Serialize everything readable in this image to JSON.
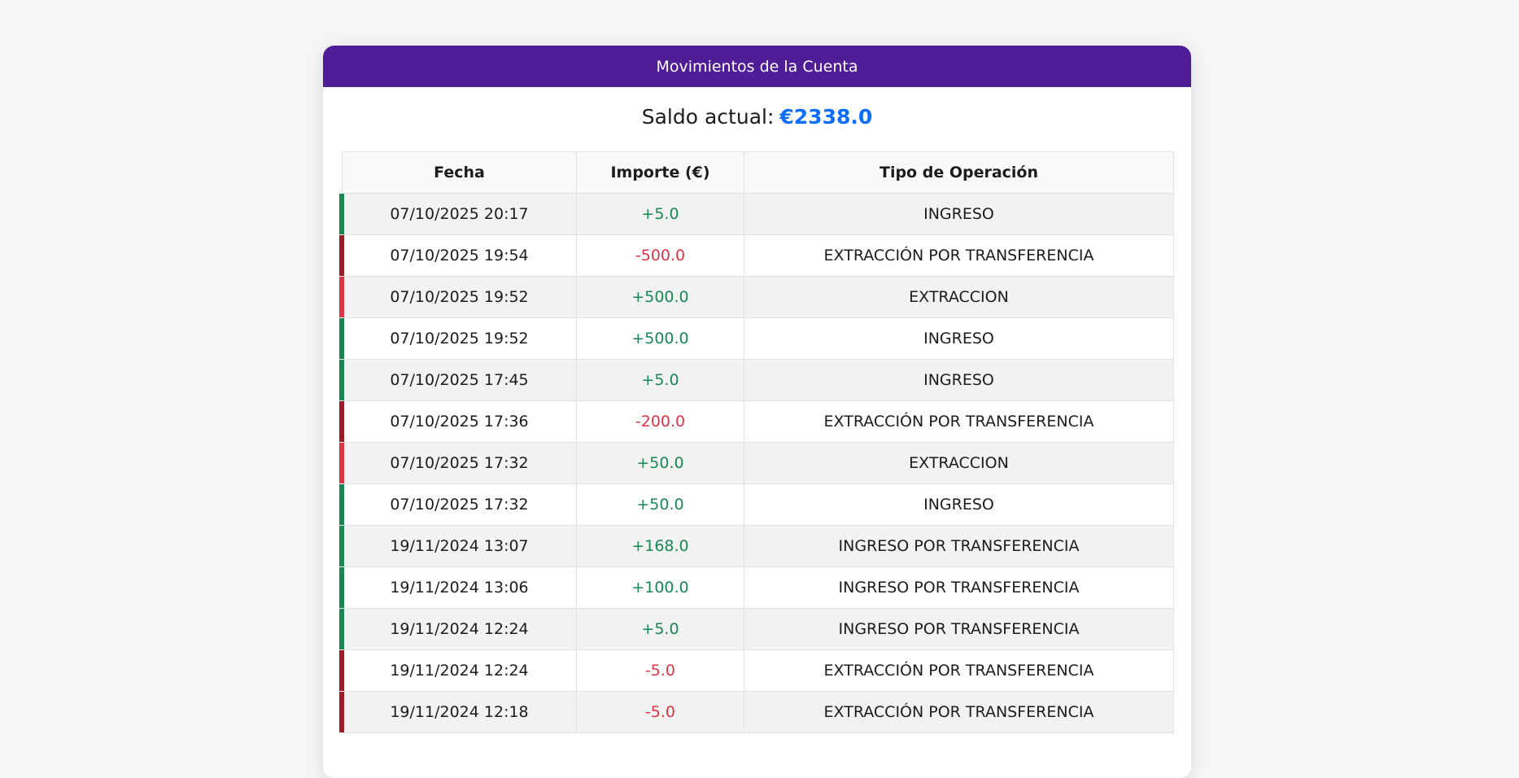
{
  "header": {
    "title": "Movimientos de la Cuenta"
  },
  "balance": {
    "label": "Saldo actual:",
    "value": "€2338.0"
  },
  "table": {
    "columns": [
      "Fecha",
      "Importe (€)",
      "Tipo de Operación"
    ],
    "rows": [
      {
        "date": "07/10/2025 20:17",
        "amount": "+5.0",
        "type": "INGRESO"
      },
      {
        "date": "07/10/2025 19:54",
        "amount": "-500.0",
        "type": "EXTRACCIÓN POR TRANSFERENCIA"
      },
      {
        "date": "07/10/2025 19:52",
        "amount": "+500.0",
        "type": "EXTRACCION"
      },
      {
        "date": "07/10/2025 19:52",
        "amount": "+500.0",
        "type": "INGRESO"
      },
      {
        "date": "07/10/2025 17:45",
        "amount": "+5.0",
        "type": "INGRESO"
      },
      {
        "date": "07/10/2025 17:36",
        "amount": "-200.0",
        "type": "EXTRACCIÓN POR TRANSFERENCIA"
      },
      {
        "date": "07/10/2025 17:32",
        "amount": "+50.0",
        "type": "EXTRACCION"
      },
      {
        "date": "07/10/2025 17:32",
        "amount": "+50.0",
        "type": "INGRESO"
      },
      {
        "date": "19/11/2024 13:07",
        "amount": "+168.0",
        "type": "INGRESO POR TRANSFERENCIA"
      },
      {
        "date": "19/11/2024 13:06",
        "amount": "+100.0",
        "type": "INGRESO POR TRANSFERENCIA"
      },
      {
        "date": "19/11/2024 12:24",
        "amount": "+5.0",
        "type": "INGRESO POR TRANSFERENCIA"
      },
      {
        "date": "19/11/2024 12:24",
        "amount": "-5.0",
        "type": "EXTRACCIÓN POR TRANSFERENCIA"
      },
      {
        "date": "19/11/2024 12:18",
        "amount": "-5.0",
        "type": "EXTRACCIÓN POR TRANSFERENCIA"
      }
    ]
  },
  "colors": {
    "header_bg": "#4f1d96",
    "balance_value": "#0d6efd",
    "positive_amount": "#198754",
    "negative_amount": "#dc3545",
    "bar_ingreso": "#198754",
    "bar_extraccion": "#dc3545",
    "bar_extraccion_transferencia": "#9b1c24"
  }
}
